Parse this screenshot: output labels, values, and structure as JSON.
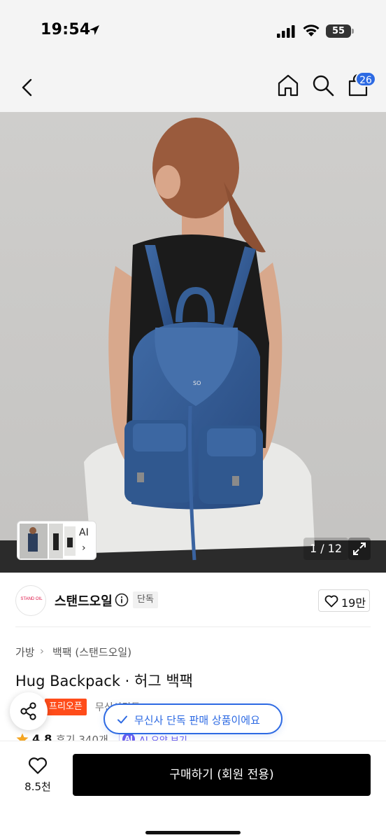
{
  "status_bar": {
    "time": "19:54",
    "battery": "55"
  },
  "nav": {
    "cart_count": "26"
  },
  "gallery": {
    "ai_label": "AI",
    "chevron": "›",
    "counter": "1 / 12"
  },
  "brand": {
    "logo_text": "STAND OIL",
    "name": "스탠드오일",
    "exclusive_tag": "단독",
    "likes": "19만"
  },
  "breadcrumb": {
    "category": "가방",
    "separator": "›",
    "subcategory": "백팩 (스탠드오일)"
  },
  "product": {
    "title": "Hug Backpack · 허그 백팩",
    "open_tag": "프리오픈",
    "free_shipping": "무신사단독",
    "rating": "4.8",
    "reviews": "후기 340개",
    "ai_summary": "AI 요약 보기",
    "ai_circle": "AI"
  },
  "toast": {
    "message": "무신사 단독 판매 상품이에요"
  },
  "bottom_bar": {
    "wish_count": "8.5천",
    "buy_label": "구매하기 (회원 전용)"
  },
  "colors": {
    "accent_blue": "#2d6ae3",
    "tag_orange": "#ff4c1a",
    "ai_purple": "#6a5cf0"
  }
}
